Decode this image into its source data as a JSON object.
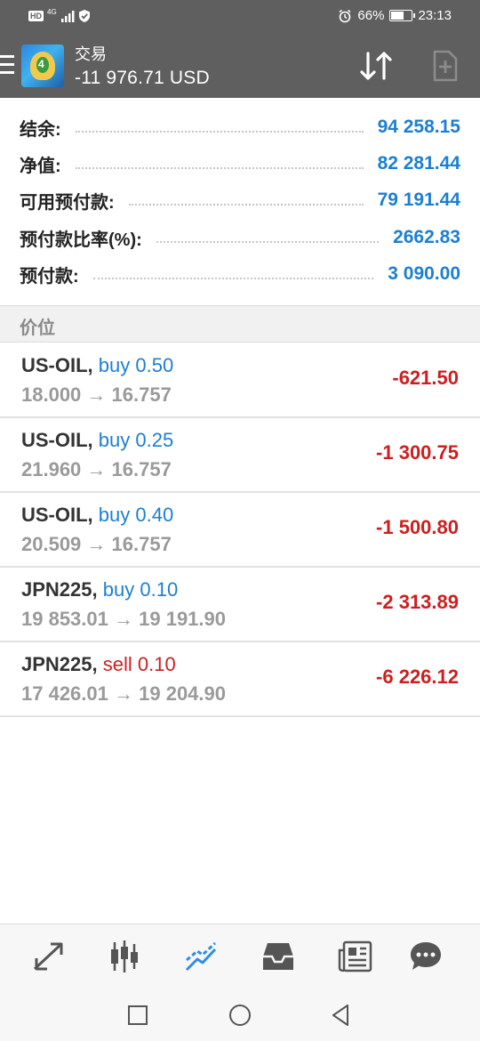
{
  "status_bar": {
    "hd": "HD",
    "net": "4G",
    "battery_percent": "66%",
    "battery_level": 0.66,
    "time": "23:13"
  },
  "app_bar": {
    "title": "交易",
    "subtitle": "-11 976.71 USD",
    "icons": [
      "menu-icon",
      "app-logo",
      "sort-icon",
      "new-order-icon"
    ]
  },
  "summary": [
    {
      "label": "结余:",
      "value": "94 258.15"
    },
    {
      "label": "净值:",
      "value": "82 281.44"
    },
    {
      "label": "可用预付款:",
      "value": "79 191.44"
    },
    {
      "label": "预付款比率(%):",
      "value": "2662.83"
    },
    {
      "label": "预付款:",
      "value": "3 090.00"
    }
  ],
  "section_title": "价位",
  "positions": [
    {
      "symbol": "US-OIL,",
      "type": "buy",
      "volume": "0.50",
      "price_open": "18.000",
      "arrow": "→",
      "price_current": "16.757",
      "profit": "-621.50"
    },
    {
      "symbol": "US-OIL,",
      "type": "buy",
      "volume": "0.25",
      "price_open": "21.960",
      "arrow": "→",
      "price_current": "16.757",
      "profit": "-1 300.75"
    },
    {
      "symbol": "US-OIL,",
      "type": "buy",
      "volume": "0.40",
      "price_open": "20.509",
      "arrow": "→",
      "price_current": "16.757",
      "profit": "-1 500.80"
    },
    {
      "symbol": "JPN225,",
      "type": "buy",
      "volume": "0.10",
      "price_open": "19 853.01",
      "arrow": "→",
      "price_current": "19 191.90",
      "profit": "-2 313.89"
    },
    {
      "symbol": "JPN225,",
      "type": "sell",
      "volume": "0.10",
      "price_open": "17 426.01",
      "arrow": "→",
      "price_current": "19 204.90",
      "profit": "-6 226.12"
    }
  ],
  "bottom_nav": [
    "quotes-icon",
    "chart-icon",
    "trade-icon",
    "history-icon",
    "news-icon",
    "chat-icon"
  ],
  "system_nav": [
    "recent-apps-icon",
    "home-icon",
    "back-icon"
  ],
  "colors": {
    "bar": "#5f5f5f",
    "accent": "#1b7fd3",
    "loss": "#cc1f1f"
  }
}
